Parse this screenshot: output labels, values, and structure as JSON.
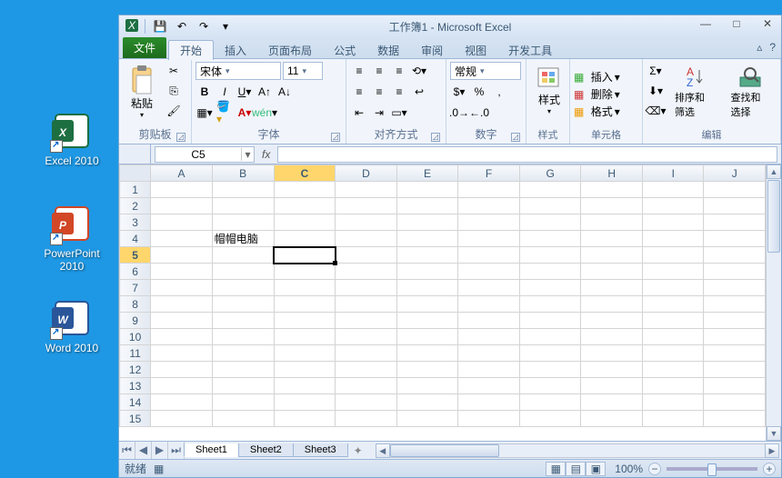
{
  "desktop_icons": [
    {
      "name": "excel-icon",
      "label": "Excel 2010",
      "color": "#1d6f42",
      "letter": "X"
    },
    {
      "name": "powerpoint-icon",
      "label": "PowerPoint 2010",
      "color": "#d24726",
      "letter": "P"
    },
    {
      "name": "word-icon",
      "label": "Word 2010",
      "color": "#2a5699",
      "letter": "W"
    }
  ],
  "title": "工作簿1 - Microsoft Excel",
  "file_tab": "文件",
  "ribbon_tabs": [
    "开始",
    "插入",
    "页面布局",
    "公式",
    "数据",
    "审阅",
    "视图",
    "开发工具"
  ],
  "active_tab_index": 0,
  "help_btn": "?",
  "qat": {
    "save": "💾",
    "undo": "↶",
    "redo": "↷"
  },
  "groups": {
    "clipboard": {
      "label": "剪贴板",
      "paste": "粘贴"
    },
    "font": {
      "label": "字体",
      "font_name": "宋体",
      "font_size": "11"
    },
    "align": {
      "label": "对齐方式"
    },
    "number": {
      "label": "数字",
      "format": "常规"
    },
    "styles": {
      "label": "样式",
      "btn": "样式"
    },
    "cells": {
      "label": "单元格",
      "insert": "插入",
      "delete": "删除",
      "format": "格式"
    },
    "editing": {
      "label": "编辑",
      "sort": "排序和筛选",
      "find": "查找和选择"
    }
  },
  "namebox": "C5",
  "fx": "fx",
  "formula_value": "",
  "columns": [
    "A",
    "B",
    "C",
    "D",
    "E",
    "F",
    "G",
    "H",
    "I",
    "J"
  ],
  "row_count": 15,
  "active_cell": {
    "row": 5,
    "col": "C"
  },
  "cell_data": {
    "B4": "帽帽电脑"
  },
  "sheets": [
    "Sheet1",
    "Sheet2",
    "Sheet3"
  ],
  "active_sheet": 0,
  "status": "就绪",
  "zoom": "100%",
  "zoom_minus": "−",
  "zoom_plus": "+",
  "macro_icon": "▦"
}
